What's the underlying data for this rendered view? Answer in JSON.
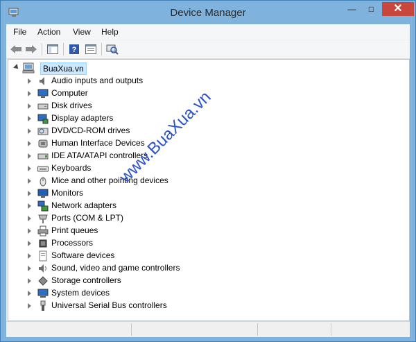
{
  "window": {
    "title": "Device Manager",
    "controls": {
      "minimize": "—",
      "maximize": "□",
      "close": "✕"
    }
  },
  "menu": [
    "File",
    "Action",
    "View",
    "Help"
  ],
  "toolbar": {
    "buttons": [
      "back-icon",
      "forward-icon",
      "show-hide-console-tree-icon",
      "help-icon",
      "properties-icon",
      "scan-hardware-icon"
    ]
  },
  "tree": {
    "root": {
      "label": "BuaXua.vn",
      "expanded": true
    },
    "categories": [
      {
        "label": "Audio inputs and outputs",
        "icon": "speaker-icon"
      },
      {
        "label": "Computer",
        "icon": "computer-icon"
      },
      {
        "label": "Disk drives",
        "icon": "disk-drive-icon"
      },
      {
        "label": "Display adapters",
        "icon": "display-adapter-icon"
      },
      {
        "label": "DVD/CD-ROM drives",
        "icon": "dvd-drive-icon"
      },
      {
        "label": "Human Interface Devices",
        "icon": "hid-icon"
      },
      {
        "label": "IDE ATA/ATAPI controllers",
        "icon": "ide-controller-icon"
      },
      {
        "label": "Keyboards",
        "icon": "keyboard-icon"
      },
      {
        "label": "Mice and other pointing devices",
        "icon": "mouse-icon"
      },
      {
        "label": "Monitors",
        "icon": "monitor-icon"
      },
      {
        "label": "Network adapters",
        "icon": "network-adapter-icon"
      },
      {
        "label": "Ports (COM & LPT)",
        "icon": "port-icon"
      },
      {
        "label": "Print queues",
        "icon": "printer-icon"
      },
      {
        "label": "Processors",
        "icon": "processor-icon"
      },
      {
        "label": "Software devices",
        "icon": "software-device-icon"
      },
      {
        "label": "Sound, video and game controllers",
        "icon": "sound-controller-icon"
      },
      {
        "label": "Storage controllers",
        "icon": "storage-controller-icon"
      },
      {
        "label": "System devices",
        "icon": "system-device-icon"
      },
      {
        "label": "Universal Serial Bus controllers",
        "icon": "usb-icon"
      }
    ]
  },
  "watermark": "www.BuaXua.vn",
  "colors": {
    "title_bar": "#7fb2dc",
    "close_button": "#c9463d",
    "selection": "#cce8ff",
    "watermark": "#2a52c9"
  }
}
